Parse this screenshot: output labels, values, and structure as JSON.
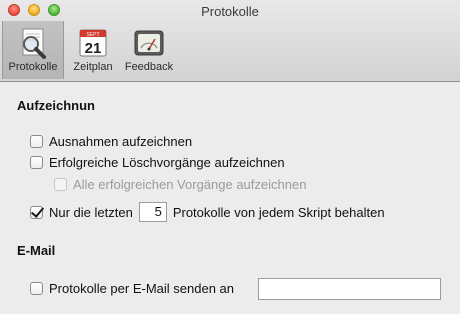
{
  "window": {
    "title": "Protokolle"
  },
  "toolbar": {
    "items": [
      {
        "label": "Protokolle",
        "icon": "magnifier-document-icon",
        "selected": true
      },
      {
        "label": "Zeitplan",
        "icon": "calendar-icon",
        "calendar_month": "SEPT",
        "calendar_day": "21",
        "selected": false
      },
      {
        "label": "Feedback",
        "icon": "gauge-icon",
        "selected": false
      }
    ]
  },
  "logging": {
    "heading": "Aufzeichnun",
    "exceptions": {
      "label": "Ausnahmen aufzeichnen",
      "checked": false
    },
    "successful_deletions": {
      "label": "Erfolgreiche Löschvorgänge aufzeichnen",
      "checked": false
    },
    "all_successful": {
      "label": "Alle erfolgreichen Vorgänge aufzeichnen",
      "checked": false,
      "enabled": false
    },
    "keep_last": {
      "prefix": "Nur die letzten",
      "value": "5",
      "suffix": "Protokolle von jedem Skript behalten",
      "checked": true
    }
  },
  "email": {
    "heading": "E-Mail",
    "send": {
      "label": "Protokolle per E-Mail senden an",
      "checked": false
    },
    "address": {
      "value": "",
      "placeholder": ""
    }
  }
}
